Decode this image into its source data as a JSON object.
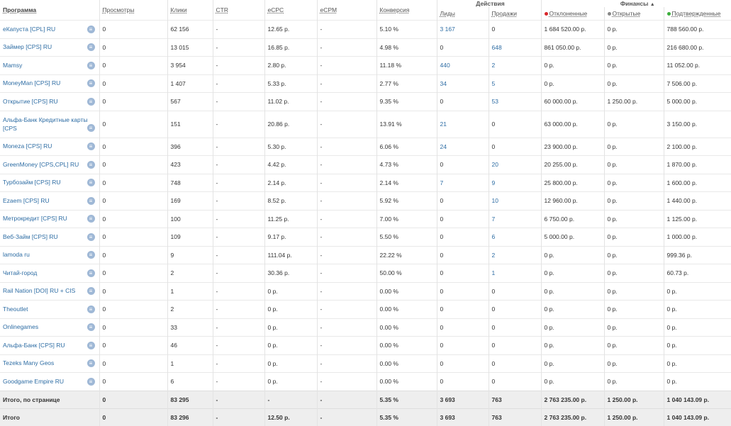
{
  "headers": {
    "program": "Программа",
    "views": "Просмотры",
    "clicks": "Клики",
    "ctr": "CTR",
    "ecpc": "eCPC",
    "ecpm": "eCPM",
    "conversion": "Конверсия",
    "actions_group": "Действия",
    "leads": "Лиды",
    "sales": "Продажи",
    "finance_group": "Финансы",
    "finance_sort_arrow": "▲",
    "rejected": "Отклоненные",
    "open": "Открытые",
    "confirmed": "Подтвержденные"
  },
  "colors": {
    "rejected": "#d9262a",
    "open": "#888888",
    "confirmed": "#3cae3c",
    "link": "#2e6da4"
  },
  "rows": [
    {
      "program": "eКапуста [CPL] RU",
      "views": "0",
      "clicks": "62 156",
      "ctr": "-",
      "ecpc": "12.65 р.",
      "ecpm": "-",
      "conversion": "5.10 %",
      "leads": "3 167",
      "leads_link": true,
      "sales": "0",
      "sales_link": false,
      "rejected": "1 684 520.00 р.",
      "open": "0 р.",
      "confirmed": "788 560.00 р."
    },
    {
      "program": "Займер [CPS] RU",
      "views": "0",
      "clicks": "13 015",
      "ctr": "-",
      "ecpc": "16.85 р.",
      "ecpm": "-",
      "conversion": "4.98 %",
      "leads": "0",
      "leads_link": false,
      "sales": "648",
      "sales_link": true,
      "rejected": "861 050.00 р.",
      "open": "0 р.",
      "confirmed": "216 680.00 р."
    },
    {
      "program": "Mamsy",
      "views": "0",
      "clicks": "3 954",
      "ctr": "-",
      "ecpc": "2.80 р.",
      "ecpm": "-",
      "conversion": "11.18 %",
      "leads": "440",
      "leads_link": true,
      "sales": "2",
      "sales_link": true,
      "rejected": "0 р.",
      "open": "0 р.",
      "confirmed": "11 052.00 р."
    },
    {
      "program": "MoneyMan [CPS] RU",
      "views": "0",
      "clicks": "1 407",
      "ctr": "-",
      "ecpc": "5.33 р.",
      "ecpm": "-",
      "conversion": "2.77 %",
      "leads": "34",
      "leads_link": true,
      "sales": "5",
      "sales_link": true,
      "rejected": "0 р.",
      "open": "0 р.",
      "confirmed": "7 506.00 р."
    },
    {
      "program": "Открытие [CPS] RU",
      "views": "0",
      "clicks": "567",
      "ctr": "-",
      "ecpc": "11.02 р.",
      "ecpm": "-",
      "conversion": "9.35 %",
      "leads": "0",
      "leads_link": false,
      "sales": "53",
      "sales_link": true,
      "rejected": "60 000.00 р.",
      "open": "1 250.00 р.",
      "confirmed": "5 000.00 р."
    },
    {
      "program": "Альфа-Банк Кредитные карты [CPS",
      "views": "0",
      "clicks": "151",
      "ctr": "-",
      "ecpc": "20.86 р.",
      "ecpm": "-",
      "conversion": "13.91 %",
      "leads": "21",
      "leads_link": true,
      "sales": "0",
      "sales_link": false,
      "rejected": "63 000.00 р.",
      "open": "0 р.",
      "confirmed": "3 150.00 р.",
      "tall": true
    },
    {
      "program": "Moneza [CPS] RU",
      "views": "0",
      "clicks": "396",
      "ctr": "-",
      "ecpc": "5.30 р.",
      "ecpm": "-",
      "conversion": "6.06 %",
      "leads": "24",
      "leads_link": true,
      "sales": "0",
      "sales_link": false,
      "rejected": "23 900.00 р.",
      "open": "0 р.",
      "confirmed": "2 100.00 р."
    },
    {
      "program": "GreenMoney [CPS,CPL] RU",
      "views": "0",
      "clicks": "423",
      "ctr": "-",
      "ecpc": "4.42 р.",
      "ecpm": "-",
      "conversion": "4.73 %",
      "leads": "0",
      "leads_link": false,
      "sales": "20",
      "sales_link": true,
      "rejected": "20 255.00 р.",
      "open": "0 р.",
      "confirmed": "1 870.00 р."
    },
    {
      "program": "Турбозайм [CPS] RU",
      "views": "0",
      "clicks": "748",
      "ctr": "-",
      "ecpc": "2.14 р.",
      "ecpm": "-",
      "conversion": "2.14 %",
      "leads": "7",
      "leads_link": true,
      "sales": "9",
      "sales_link": true,
      "rejected": "25 800.00 р.",
      "open": "0 р.",
      "confirmed": "1 600.00 р."
    },
    {
      "program": "Ezaem [CPS] RU",
      "views": "0",
      "clicks": "169",
      "ctr": "-",
      "ecpc": "8.52 р.",
      "ecpm": "-",
      "conversion": "5.92 %",
      "leads": "0",
      "leads_link": false,
      "sales": "10",
      "sales_link": true,
      "rejected": "12 960.00 р.",
      "open": "0 р.",
      "confirmed": "1 440.00 р."
    },
    {
      "program": "Метрокредит [CPS] RU",
      "views": "0",
      "clicks": "100",
      "ctr": "-",
      "ecpc": "11.25 р.",
      "ecpm": "-",
      "conversion": "7.00 %",
      "leads": "0",
      "leads_link": false,
      "sales": "7",
      "sales_link": true,
      "rejected": "6 750.00 р.",
      "open": "0 р.",
      "confirmed": "1 125.00 р."
    },
    {
      "program": "Веб-Займ [CPS] RU",
      "views": "0",
      "clicks": "109",
      "ctr": "-",
      "ecpc": "9.17 р.",
      "ecpm": "-",
      "conversion": "5.50 %",
      "leads": "0",
      "leads_link": false,
      "sales": "6",
      "sales_link": true,
      "rejected": "5 000.00 р.",
      "open": "0 р.",
      "confirmed": "1 000.00 р."
    },
    {
      "program": "lamoda ru",
      "views": "0",
      "clicks": "9",
      "ctr": "-",
      "ecpc": "111.04 р.",
      "ecpm": "-",
      "conversion": "22.22 %",
      "leads": "0",
      "leads_link": false,
      "sales": "2",
      "sales_link": true,
      "rejected": "0 р.",
      "open": "0 р.",
      "confirmed": "999.36 р."
    },
    {
      "program": "Читай-город",
      "views": "0",
      "clicks": "2",
      "ctr": "-",
      "ecpc": "30.36 р.",
      "ecpm": "-",
      "conversion": "50.00 %",
      "leads": "0",
      "leads_link": false,
      "sales": "1",
      "sales_link": true,
      "rejected": "0 р.",
      "open": "0 р.",
      "confirmed": "60.73 р."
    },
    {
      "program": "Rail Nation [DOI] RU + CIS",
      "views": "0",
      "clicks": "1",
      "ctr": "-",
      "ecpc": "0 р.",
      "ecpm": "-",
      "conversion": "0.00 %",
      "leads": "0",
      "leads_link": false,
      "sales": "0",
      "sales_link": false,
      "rejected": "0 р.",
      "open": "0 р.",
      "confirmed": "0 р."
    },
    {
      "program": "Theoutlet",
      "views": "0",
      "clicks": "2",
      "ctr": "-",
      "ecpc": "0 р.",
      "ecpm": "-",
      "conversion": "0.00 %",
      "leads": "0",
      "leads_link": false,
      "sales": "0",
      "sales_link": false,
      "rejected": "0 р.",
      "open": "0 р.",
      "confirmed": "0 р."
    },
    {
      "program": "Onlinegames",
      "views": "0",
      "clicks": "33",
      "ctr": "-",
      "ecpc": "0 р.",
      "ecpm": "-",
      "conversion": "0.00 %",
      "leads": "0",
      "leads_link": false,
      "sales": "0",
      "sales_link": false,
      "rejected": "0 р.",
      "open": "0 р.",
      "confirmed": "0 р."
    },
    {
      "program": "Альфа-Банк [CPS] RU",
      "views": "0",
      "clicks": "46",
      "ctr": "-",
      "ecpc": "0 р.",
      "ecpm": "-",
      "conversion": "0.00 %",
      "leads": "0",
      "leads_link": false,
      "sales": "0",
      "sales_link": false,
      "rejected": "0 р.",
      "open": "0 р.",
      "confirmed": "0 р."
    },
    {
      "program": "Tezeks Many Geos",
      "views": "0",
      "clicks": "1",
      "ctr": "-",
      "ecpc": "0 р.",
      "ecpm": "-",
      "conversion": "0.00 %",
      "leads": "0",
      "leads_link": false,
      "sales": "0",
      "sales_link": false,
      "rejected": "0 р.",
      "open": "0 р.",
      "confirmed": "0 р."
    },
    {
      "program": "Goodgame Empire RU",
      "views": "0",
      "clicks": "6",
      "ctr": "-",
      "ecpc": "0 р.",
      "ecpm": "-",
      "conversion": "0.00 %",
      "leads": "0",
      "leads_link": false,
      "sales": "0",
      "sales_link": false,
      "rejected": "0 р.",
      "open": "0 р.",
      "confirmed": "0 р."
    }
  ],
  "totals": [
    {
      "label": "Итого, по странице",
      "views": "0",
      "clicks": "83 295",
      "ctr": "-",
      "ecpc": "-",
      "ecpm": "-",
      "conversion": "5.35 %",
      "leads": "3 693",
      "sales": "763",
      "rejected": "2 763 235.00 р.",
      "open": "1 250.00 р.",
      "confirmed": "1 040 143.09 р."
    },
    {
      "label": "Итого",
      "views": "0",
      "clicks": "83 296",
      "ctr": "-",
      "ecpc": "12.50 р.",
      "ecpm": "-",
      "conversion": "5.35 %",
      "leads": "3 693",
      "sales": "763",
      "rejected": "2 763 235.00 р.",
      "open": "1 250.00 р.",
      "confirmed": "1 040 143.09 р."
    }
  ]
}
